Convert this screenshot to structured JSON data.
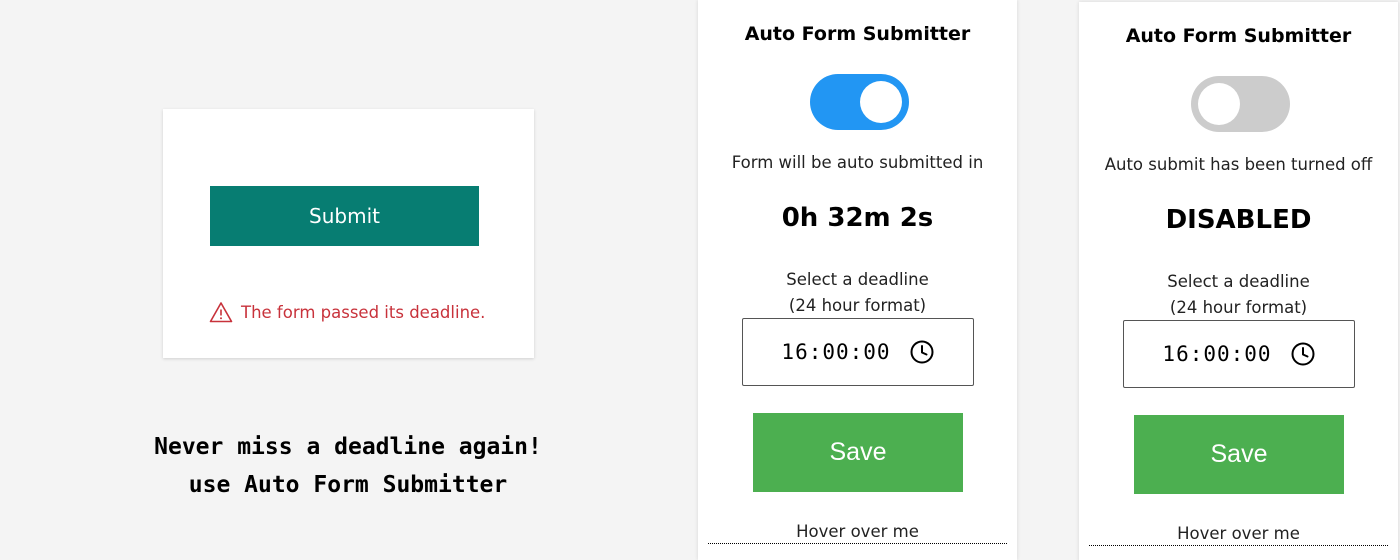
{
  "promo": {
    "submit_label": "Submit",
    "error_message": "The form passed its deadline.",
    "tagline_line1": "Never miss a deadline again!",
    "tagline_line2": "use Auto Form Submitter"
  },
  "panels": [
    {
      "title": "Auto Form Submitter",
      "toggle_state": "on",
      "status_text": "Form will be auto submitted in",
      "countdown": "0h 32m 2s",
      "deadline_label_line1": "Select a deadline",
      "deadline_label_line2": "(24 hour format)",
      "time_value": "16:00:00",
      "save_label": "Save",
      "hover_text": "Hover over me"
    },
    {
      "title": "Auto Form Submitter",
      "toggle_state": "off",
      "status_text": "Auto submit has been turned off",
      "countdown": "DISABLED",
      "deadline_label_line1": "Select a deadline",
      "deadline_label_line2": "(24 hour format)",
      "time_value": "16:00:00",
      "save_label": "Save",
      "hover_text": "Hover over me"
    }
  ],
  "icons": {
    "warning": "warning-triangle-icon",
    "clock": "clock-icon"
  },
  "colors": {
    "submit_button": "#077d72",
    "error_text": "#c8323b",
    "toggle_on": "#2296f3",
    "toggle_off": "#cccccc",
    "save_button": "#4caf50"
  }
}
